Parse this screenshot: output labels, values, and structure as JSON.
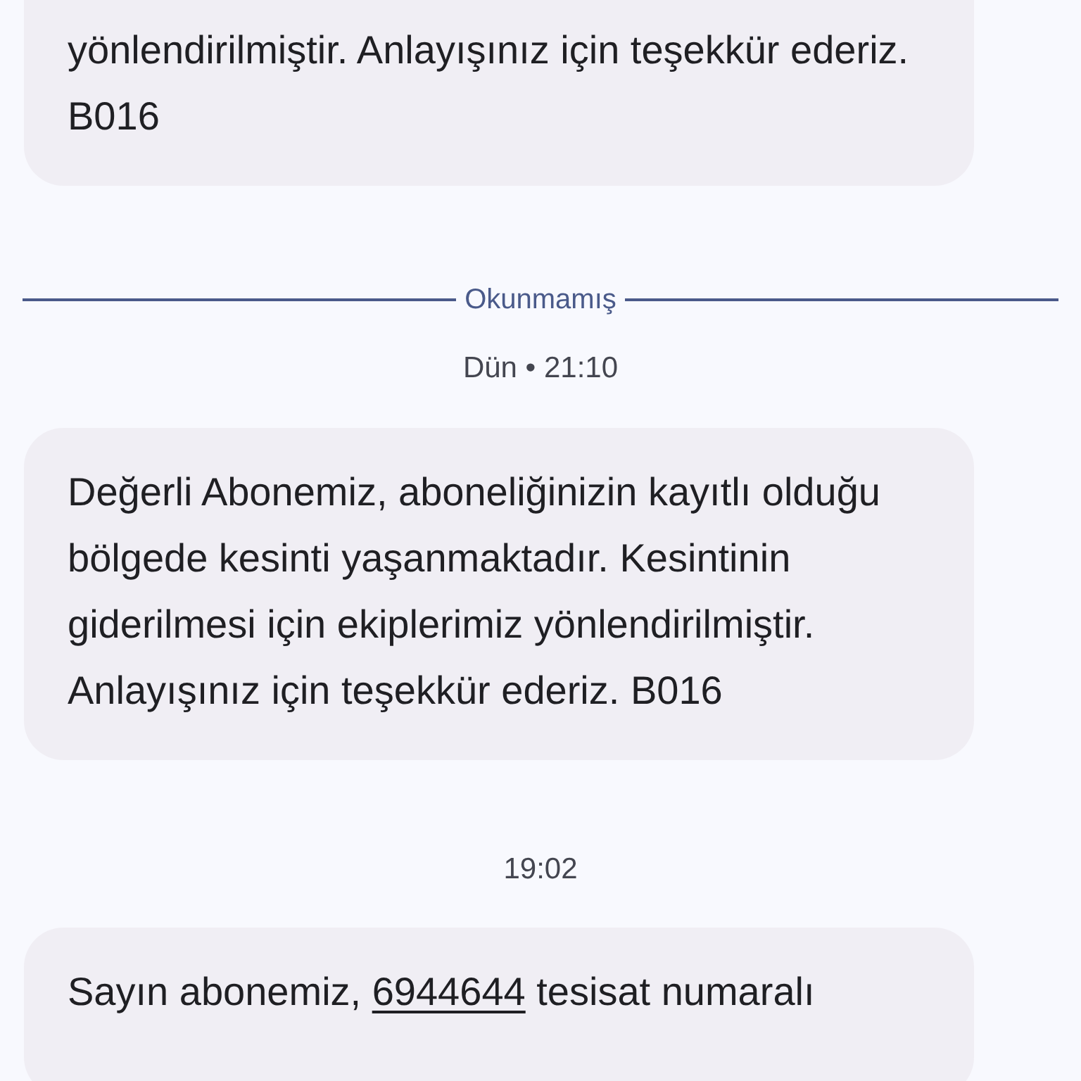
{
  "conversation": [
    {
      "kind": "message",
      "parts": [
        {
          "kind": "text",
          "text": "yönlendirilmiştir. Anlayışınız için teşekkür ederiz. B016"
        }
      ]
    },
    {
      "kind": "divider",
      "text": "Okunmamış"
    },
    {
      "kind": "timestamp",
      "text": "Dün • 21:10"
    },
    {
      "kind": "message",
      "parts": [
        {
          "kind": "text",
          "text": "Değerli Abonemiz, aboneliğinizin kayıtlı olduğu bölgede kesinti yaşanmaktadır. Kesintinin giderilmesi için ekiplerimiz yönlendirilmiştir. Anlayışınız için teşekkür ederiz. B016"
        }
      ]
    },
    {
      "kind": "timestamp",
      "text": "19:02"
    },
    {
      "kind": "message",
      "parts": [
        {
          "kind": "text",
          "text": "Sayın abonemiz, "
        },
        {
          "kind": "link",
          "text": "6944644"
        },
        {
          "kind": "text",
          "text": " tesisat numaralı"
        }
      ]
    }
  ]
}
